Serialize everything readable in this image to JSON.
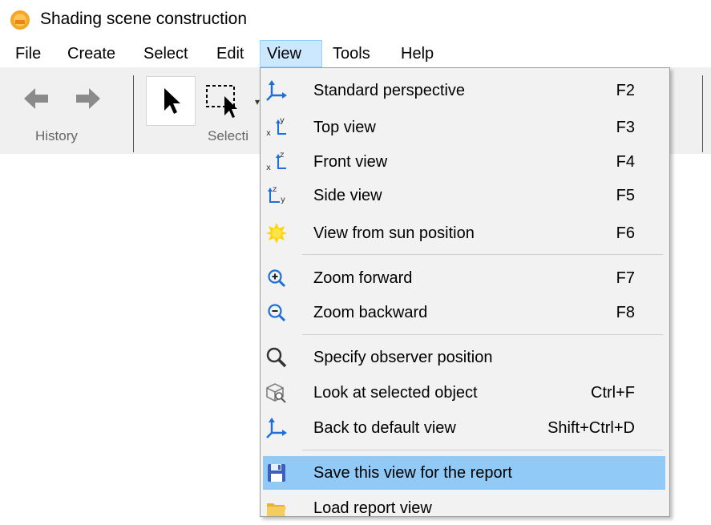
{
  "window": {
    "title": "Shading scene construction"
  },
  "menubar": {
    "items": [
      {
        "label": "File"
      },
      {
        "label": "Create"
      },
      {
        "label": "Select"
      },
      {
        "label": "Edit"
      },
      {
        "label": "View",
        "active": true
      },
      {
        "label": "Tools"
      },
      {
        "label": "Help"
      }
    ]
  },
  "toolbar": {
    "groups": [
      {
        "label": "History",
        "icons": [
          "back-arrow-icon",
          "forward-arrow-icon"
        ]
      },
      {
        "label": "Selecti",
        "icons": [
          "pointer-icon",
          "rectangle-select-icon"
        ]
      }
    ]
  },
  "view_menu": {
    "items": [
      {
        "label": "Standard perspective",
        "shortcut": "F2",
        "icon": "perspective-axes-icon"
      },
      {
        "label": "Top view",
        "shortcut": "F3",
        "icon": "top-view-axes-icon"
      },
      {
        "label": "Front view",
        "shortcut": "F4",
        "icon": "front-view-axes-icon"
      },
      {
        "label": "Side view",
        "shortcut": "F5",
        "icon": "side-view-axes-icon"
      },
      {
        "label": "View from sun position",
        "shortcut": "F6",
        "icon": "sun-icon"
      },
      {
        "label": "Zoom forward",
        "shortcut": "F7",
        "icon": "zoom-in-icon"
      },
      {
        "label": "Zoom backward",
        "shortcut": "F8",
        "icon": "zoom-out-icon"
      },
      {
        "label": "Specify observer position",
        "shortcut": "",
        "icon": "magnifier-icon"
      },
      {
        "label": "Look at selected object",
        "shortcut": "Ctrl+F",
        "icon": "look-at-object-icon"
      },
      {
        "label": "Back to default view",
        "shortcut": "Shift+Ctrl+D",
        "icon": "default-view-axes-icon"
      },
      {
        "label": "Save this view for the report",
        "shortcut": "",
        "icon": "save-disk-icon",
        "highlighted": true
      },
      {
        "label": "Load report view",
        "shortcut": "",
        "icon": "folder-icon"
      }
    ]
  },
  "colors": {
    "menu_highlight": "#91c9f7",
    "active_menu": "#cce8ff",
    "icon_blue": "#1e6fd9",
    "sun": "#ffd400"
  }
}
